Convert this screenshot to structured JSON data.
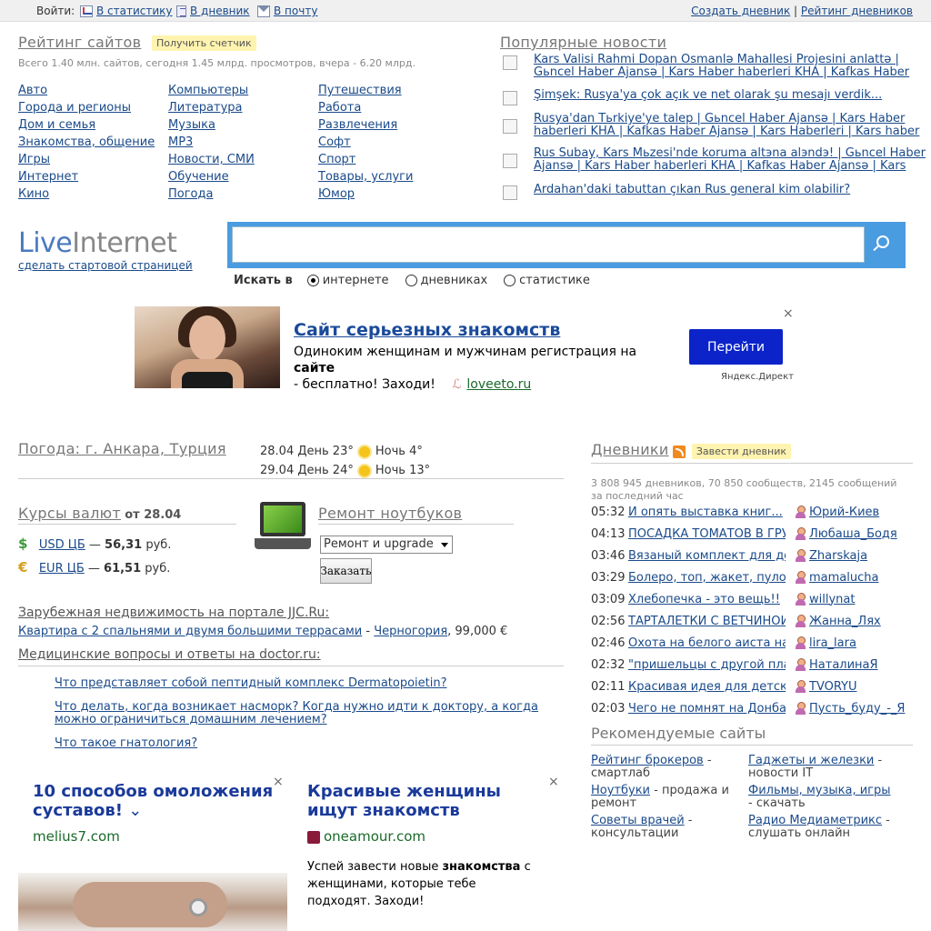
{
  "topbar": {
    "login_label": "Войти:",
    "links": [
      {
        "label": "В статистику",
        "icon": "chart-icon"
      },
      {
        "label": "В дневник",
        "icon": "diary-icon"
      },
      {
        "label": "В почту",
        "icon": "mail-icon"
      }
    ],
    "create_diary": "Создать дневник",
    "separator": "|",
    "diary_rating": "Рейтинг дневников"
  },
  "rating": {
    "title": "Рейтинг сайтов",
    "badge": "Получить счетчик",
    "stats": "Всего 1.40 млн. сайтов, сегодня 1.45 млрд. просмотров, вчера - 6.20 млрд.",
    "col1": [
      "Авто",
      "Города и регионы",
      "Дом и семья",
      "Знакомства, общение",
      "Игры",
      "Интернет",
      "Кино"
    ],
    "col2": [
      "Компьютеры",
      "Литература",
      "Музыка",
      "MP3",
      "Новости, СМИ",
      "Обучение",
      "Погода"
    ],
    "col3": [
      "Путешествия",
      "Работа",
      "Развлечения",
      "Софт",
      "Спорт",
      "Товары, услуги",
      "Юмор"
    ]
  },
  "news": {
    "title": "Популярные новости",
    "items": [
      "Kars Valisi Rahmi Dopan Osmanlə Mahallesi Projesini anlattə | Gьncel Haber Ajansə | Kars Haber haberleri KHA | Kafkas Haber Ajansə | Kars",
      "Şimşek: Rusya'ya çok açık ve net olarak şu mesajı verdik...",
      "Rusya'dan Tьrkiye'ye talep | Gьncel Haber Ajansə | Kars Haber haberleri KHA | Kafkas Haber Ajansə | Kars Haberleri | Kars haber kars haberleri",
      "Rus Subay, Kars Mьzesi'nde koruma altэna alэndэ! | Gьncel Haber Ajansə | Kars Haber haberleri KHA | Kafkas Haber Ajansə | Kars",
      "Ardahan'daki tabuttan çıkan Rus general kim olabilir?"
    ]
  },
  "logo": {
    "live": "Live",
    "internet": "Internet",
    "start_page": "сделать стартовой страницей"
  },
  "search": {
    "placeholder": "",
    "label": "Искать в",
    "options": [
      "интернете",
      "дневниках",
      "статистике"
    ],
    "selected": "интернете"
  },
  "ad1": {
    "title": "Сайт серьезных знакомств",
    "text1": "Одиноким женщинам и мужчинам регистрация на ",
    "text_bold": "сайте",
    "text2": "- бесплатно! Заходи!",
    "domain": "loveeto.ru",
    "button": "Перейти",
    "source": "Яндекс.Директ",
    "close": "×"
  },
  "weather": {
    "title": "Погода: г. Анкара, Турция",
    "days": [
      {
        "date": "28.04",
        "day": "День 23°",
        "night": "Ночь 4°"
      },
      {
        "date": "29.04",
        "day": "День 24°",
        "night": "Ночь 13°"
      }
    ]
  },
  "currency": {
    "title": "Курсы валют",
    "date": "от 28.04",
    "rates": [
      {
        "name": "USD ЦБ",
        "dash": "—",
        "value": "56,31",
        "unit": "руб.",
        "sym": "$"
      },
      {
        "name": "EUR ЦБ",
        "dash": "—",
        "value": "61,51",
        "unit": "руб.",
        "sym": "€"
      }
    ]
  },
  "repair": {
    "title": "Ремонт ноутбуков",
    "select": "Ремонт и upgrade",
    "button": "Заказать"
  },
  "realty": {
    "title": "Зарубежная недвижимость на портале JJC.Ru:",
    "link": "Квартира с 2 спальнями и двумя большими террасами",
    "dash": "-",
    "location": "Черногория",
    "price": ", 99,000 €"
  },
  "medical": {
    "title": "Медицинские вопросы и ответы на doctor.ru:",
    "questions": [
      "Что представляет собой пептидный комплекс Dermatopoietin?",
      "Что делать, когда возникает насморк? Когда нужно идти к доктору, а когда можно ограничиться домашним лечением?",
      "Что такое гнатология?"
    ]
  },
  "diaries": {
    "title": "Дневники",
    "badge": "Завести дневник",
    "stats": "3 808 945 дневников, 70 850 сообществ, 2145 сообщений за последний час",
    "rows": [
      {
        "time": "05:32",
        "title": "И опять выставка книг...",
        "user": "Юрий-Киев"
      },
      {
        "time": "04:13",
        "title": "ПОСАДКА ТОМАТОВ В ГРУНТ",
        "user": "Любаша_Бодя"
      },
      {
        "time": "03:46",
        "title": "Вязаный комплект для девочки",
        "user": "Zharskaja"
      },
      {
        "time": "03:29",
        "title": "Болеро, топ, жакет, пуловер",
        "user": "mamalucha"
      },
      {
        "time": "03:09",
        "title": "Хлебопечка - это вещь!!",
        "user": "willynat"
      },
      {
        "time": "02:56",
        "title": "ТАРТАЛЕТКИ С ВЕТЧИНОЙ И СЫРОМ",
        "user": "Жанна_Лях"
      },
      {
        "time": "02:46",
        "title": "Охота на белого аиста на Кубани",
        "user": "lira_lara"
      },
      {
        "time": "02:32",
        "title": "\"пришельцы с другой планеты\"",
        "user": "НаталинаЯ"
      },
      {
        "time": "02:11",
        "title": "Красивая идея для детской",
        "user": "TVORYU"
      },
      {
        "time": "02:03",
        "title": "Чего не помнят на Донбассе",
        "user": "Пусть_буду_-_Я"
      }
    ]
  },
  "recommended": {
    "title": "Рекомендуемые сайты",
    "items": [
      {
        "link": "Рейтинг брокеров",
        "desc": " - смартлаб"
      },
      {
        "link": "Гаджеты и железки",
        "desc": " - новости IT"
      },
      {
        "link": "Ноутбуки",
        "desc": " - продажа и ремонт"
      },
      {
        "link": "Фильмы, музыка, игры",
        "desc": " - скачать"
      },
      {
        "link": "Советы врачей",
        "desc": " - консультации"
      },
      {
        "link": "Радио Медиаметрикс",
        "desc": " - слушать онлайн"
      }
    ]
  },
  "ad3": {
    "title": "10 способов омоложения суставов!",
    "chevron": "⌄",
    "domain": "melius7.com",
    "close": "×"
  },
  "ad4": {
    "title": "Красивые женщины ищут знакомств",
    "domain": "oneamour.com",
    "text1": "Успей завести новые ",
    "text_bold": "знакомства",
    "text2": " с женщинами, которые тебе подходят. Заходи!",
    "close": "×"
  }
}
